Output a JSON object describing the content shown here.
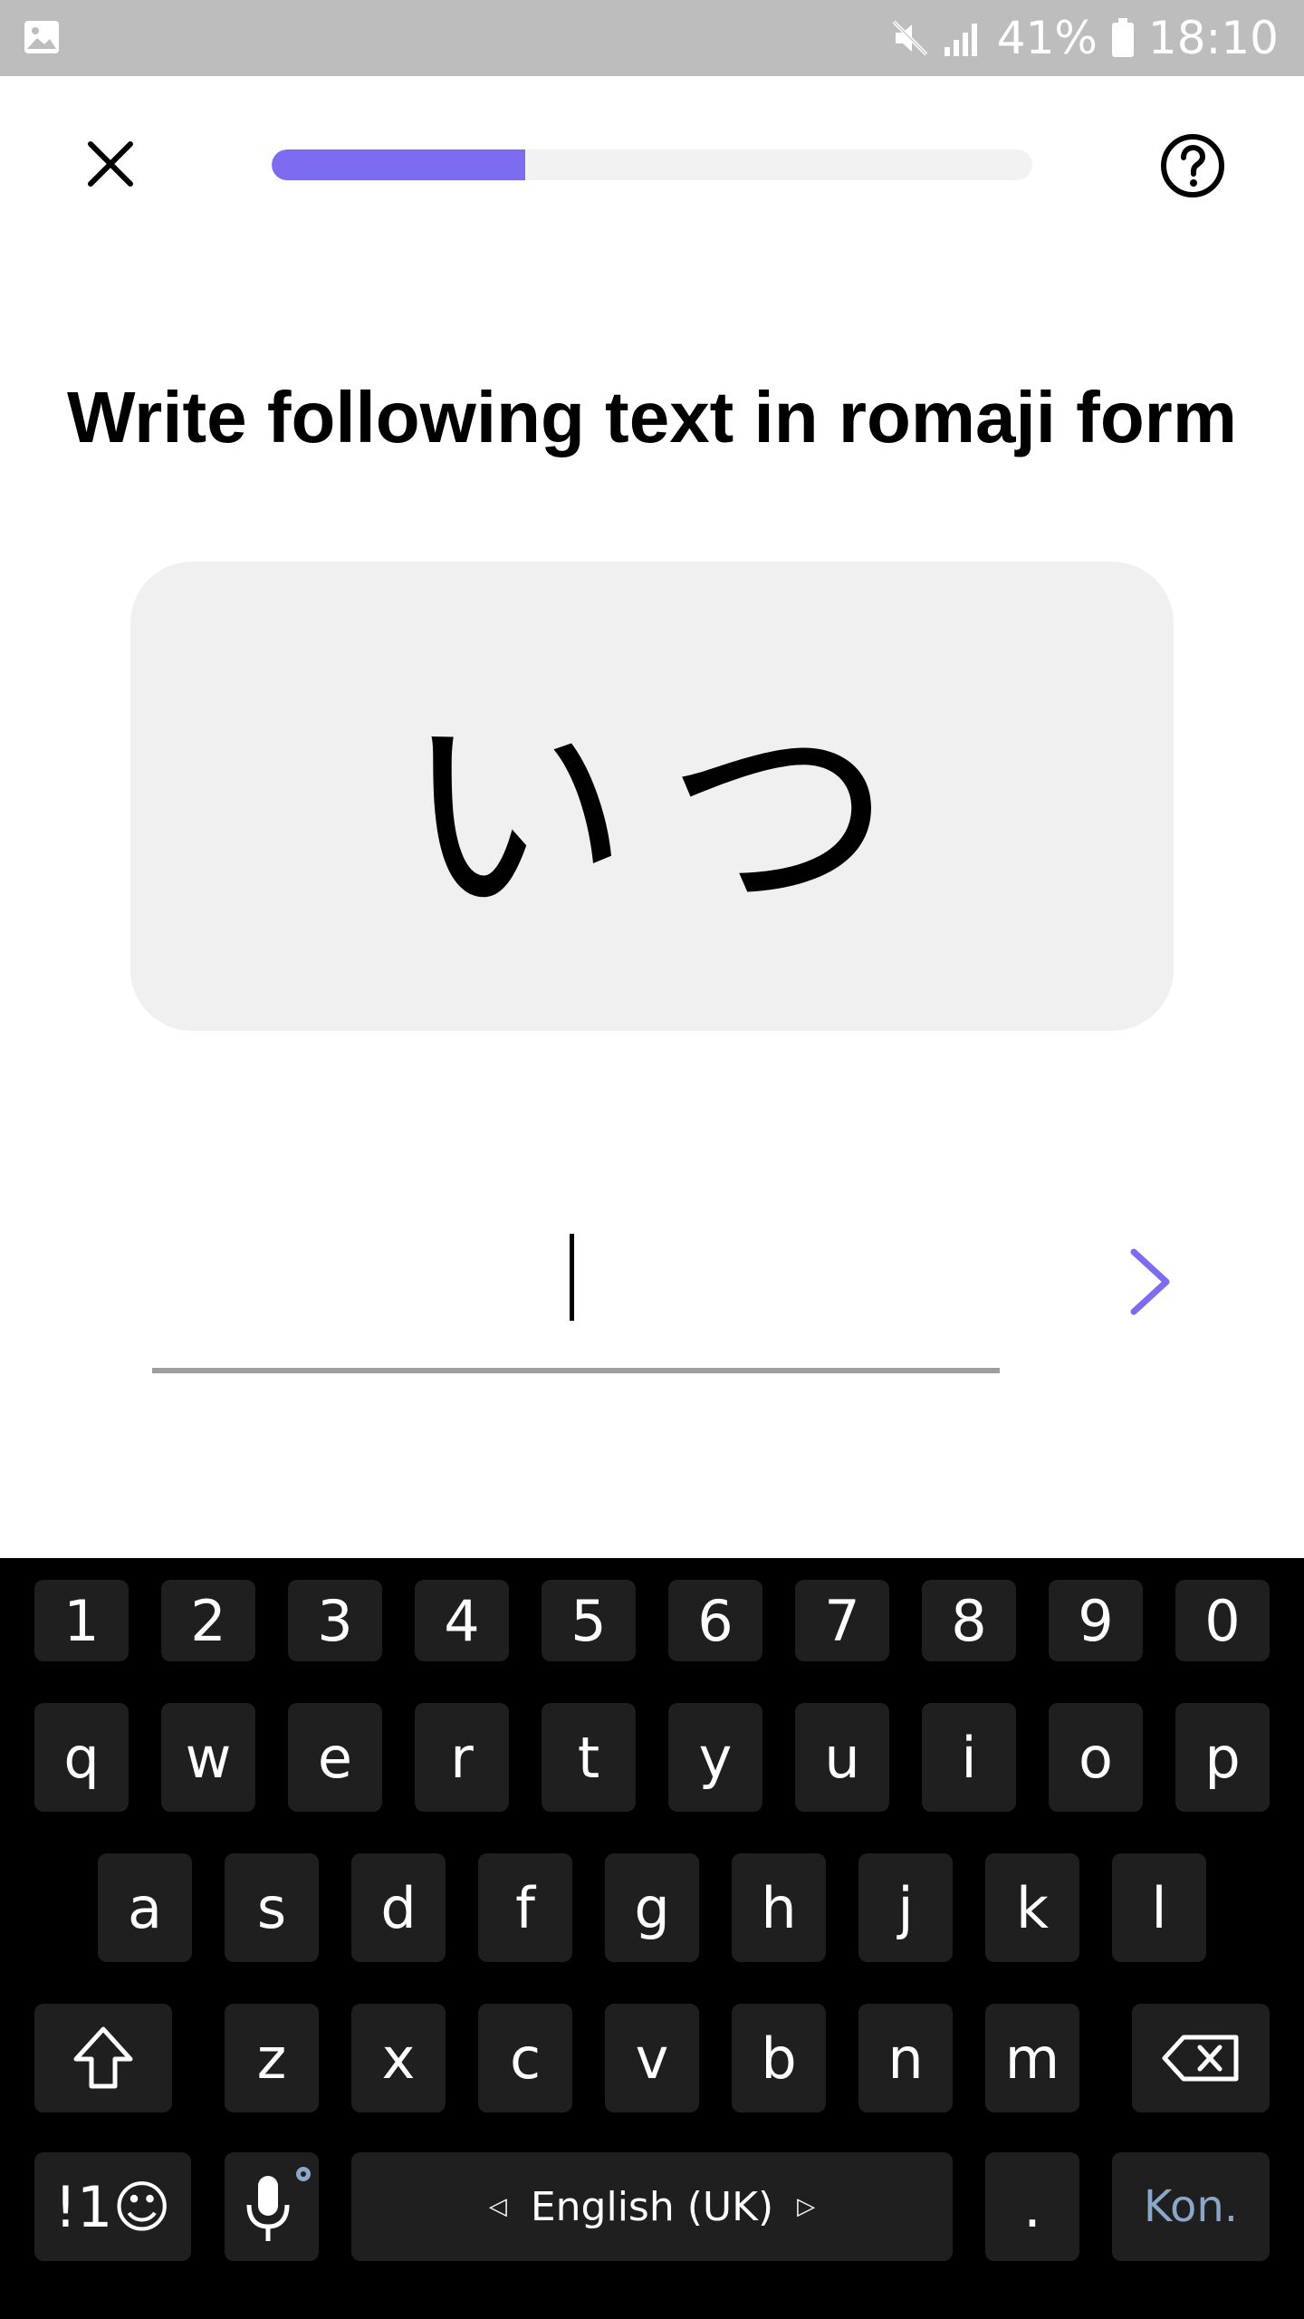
{
  "status_bar": {
    "battery_percent": "41%",
    "time": "18:10"
  },
  "header": {
    "progress_fraction": 0.333
  },
  "instruction": "Write following text in romaji form",
  "prompt_text": "いつ",
  "answer": {
    "value": "",
    "placeholder": ""
  },
  "keyboard": {
    "number_row": [
      "1",
      "2",
      "3",
      "4",
      "5",
      "6",
      "7",
      "8",
      "9",
      "0"
    ],
    "row1": [
      "q",
      "w",
      "e",
      "r",
      "t",
      "y",
      "u",
      "i",
      "o",
      "p"
    ],
    "row2": [
      "a",
      "s",
      "d",
      "f",
      "g",
      "h",
      "j",
      "k",
      "l"
    ],
    "row3": [
      "z",
      "x",
      "c",
      "v",
      "b",
      "n",
      "m"
    ],
    "symbols_label": "!1☺",
    "space_label": "English (UK)",
    "period_label": ".",
    "enter_label": "Kon."
  },
  "colors": {
    "accent": "#7b6cf0",
    "keyboard_bg": "#000000",
    "key_bg": "#1f1f1f",
    "card_bg": "#f0f0f0"
  }
}
